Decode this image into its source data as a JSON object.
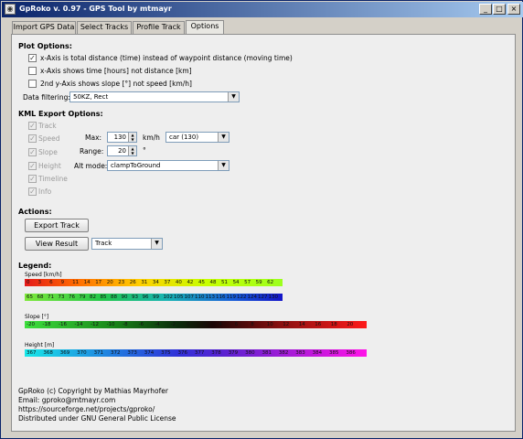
{
  "window": {
    "title": "GpRoko v. 0.97 - GPS Tool by mtmayr",
    "controls": [
      "_",
      "□",
      "×"
    ]
  },
  "tabs": [
    {
      "label": "Import GPS Data"
    },
    {
      "label": "Select Tracks"
    },
    {
      "label": "Profile Track"
    },
    {
      "label": "Options"
    }
  ],
  "plot_options": {
    "heading": "Plot Options:",
    "items": [
      {
        "label": "x-Axis is total distance (time) instead of waypoint distance (moving time)",
        "checked": true
      },
      {
        "label": "x-Axis shows time [hours] not distance [km]",
        "checked": false
      },
      {
        "label": "2nd y-Axis shows slope [°] not speed [km/h]",
        "checked": false
      }
    ],
    "filter_label": "Data filtering:",
    "filter_value": "50KZ, Rect"
  },
  "kml": {
    "heading": "KML Export Options:",
    "items": [
      {
        "label": "Track",
        "checked": true
      },
      {
        "label": "Speed",
        "checked": true
      },
      {
        "label": "Slope",
        "checked": true
      },
      {
        "label": "Height",
        "checked": true
      },
      {
        "label": "Timeline",
        "checked": true
      },
      {
        "label": "Info",
        "checked": true
      }
    ],
    "max_label": "Max:",
    "max_value": "130",
    "max_unit": "km/h",
    "vehicle_value": "car (130)",
    "range_label": "Range:",
    "range_value": "20",
    "range_unit": "°",
    "alt_label": "Alt mode:",
    "alt_value": "clampToGround"
  },
  "actions": {
    "heading": "Actions:",
    "export_label": "Export Track",
    "view_label": "View Result",
    "view_option": "Track"
  },
  "legend": {
    "heading": "Legend:",
    "speed_title": "Speed [km/h]",
    "speed_ticks_1": [
      "0",
      "3",
      "6",
      "9",
      "11",
      "14",
      "17",
      "20",
      "23",
      "26",
      "31",
      "34",
      "37",
      "40",
      "42",
      "45",
      "48",
      "51",
      "54",
      "57",
      "59",
      "62"
    ],
    "speed_ticks_2": [
      "65",
      "68",
      "71",
      "73",
      "76",
      "79",
      "82",
      "85",
      "88",
      "90",
      "93",
      "96",
      "99",
      "102",
      "105",
      "107",
      "110",
      "113",
      "116",
      "119",
      "122",
      "124",
      "127",
      "130"
    ],
    "slope_title": "Slope [°]",
    "slope_ticks": [
      "-20",
      "-18",
      "-16",
      "-14",
      "-12",
      "-10",
      "-8",
      "-6",
      "-4",
      "-2",
      "0",
      "2",
      "4",
      "6",
      "8",
      "10",
      "12",
      "14",
      "16",
      "18",
      "20"
    ],
    "height_title": "Height [m]",
    "height_ticks": [
      "367",
      "368",
      "369",
      "370",
      "371",
      "372",
      "373",
      "374",
      "375",
      "376",
      "377",
      "378",
      "379",
      "380",
      "381",
      "382",
      "383",
      "384",
      "385",
      "386"
    ]
  },
  "footer": {
    "lines": [
      "GpRoko (c) Copyright by Mathias Mayrhofer",
      "Email: gproko@mtmayr.com",
      "https://sourceforge.net/projects/gproko/",
      "Distributed under GNU General Public License"
    ]
  },
  "colors": {
    "title_start": "#0a246a",
    "title_end": "#a6caf0",
    "panel": "#eeeeee",
    "frame": "#d4d0c8"
  }
}
